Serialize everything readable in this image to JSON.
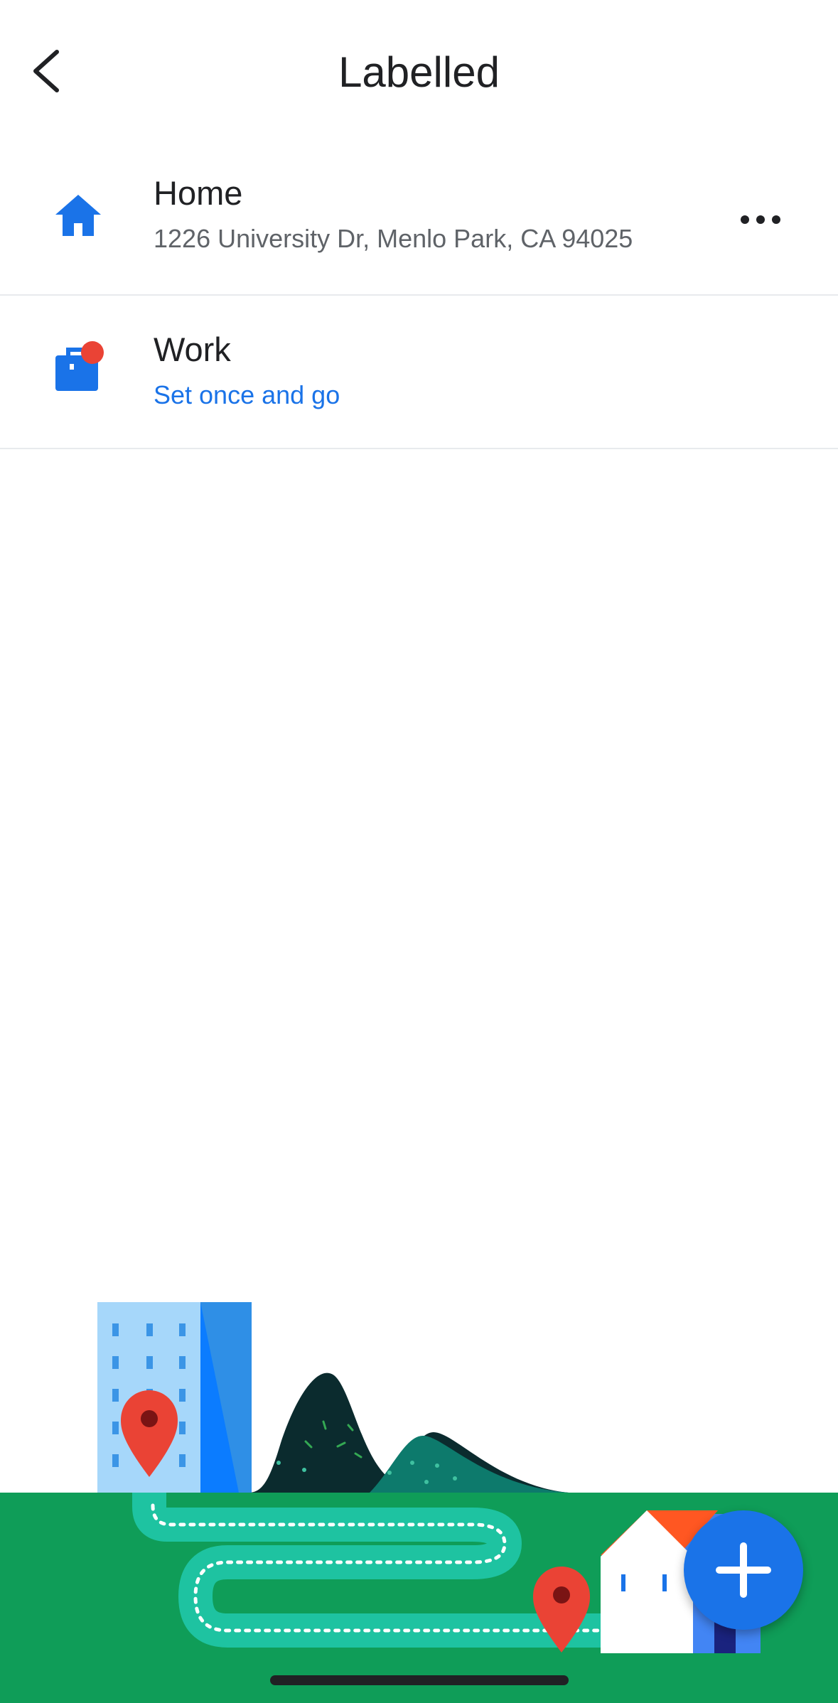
{
  "header": {
    "title": "Labelled",
    "back_icon": "chevron-left-icon"
  },
  "places": [
    {
      "icon": "home-icon",
      "title": "Home",
      "subtitle": "1226 University Dr, Menlo Park, CA 94025",
      "more_icon": "more-horizontal-icon"
    },
    {
      "icon": "work-briefcase-icon",
      "title": "Work",
      "subtitle": "Set once and go",
      "badge_color": "#ea4335"
    }
  ],
  "fab": {
    "icon": "plus-icon"
  },
  "colors": {
    "accent": "#1a73e8",
    "grass": "#0f9d58",
    "path": "#1ec3a1",
    "pin": "#ea4335"
  }
}
